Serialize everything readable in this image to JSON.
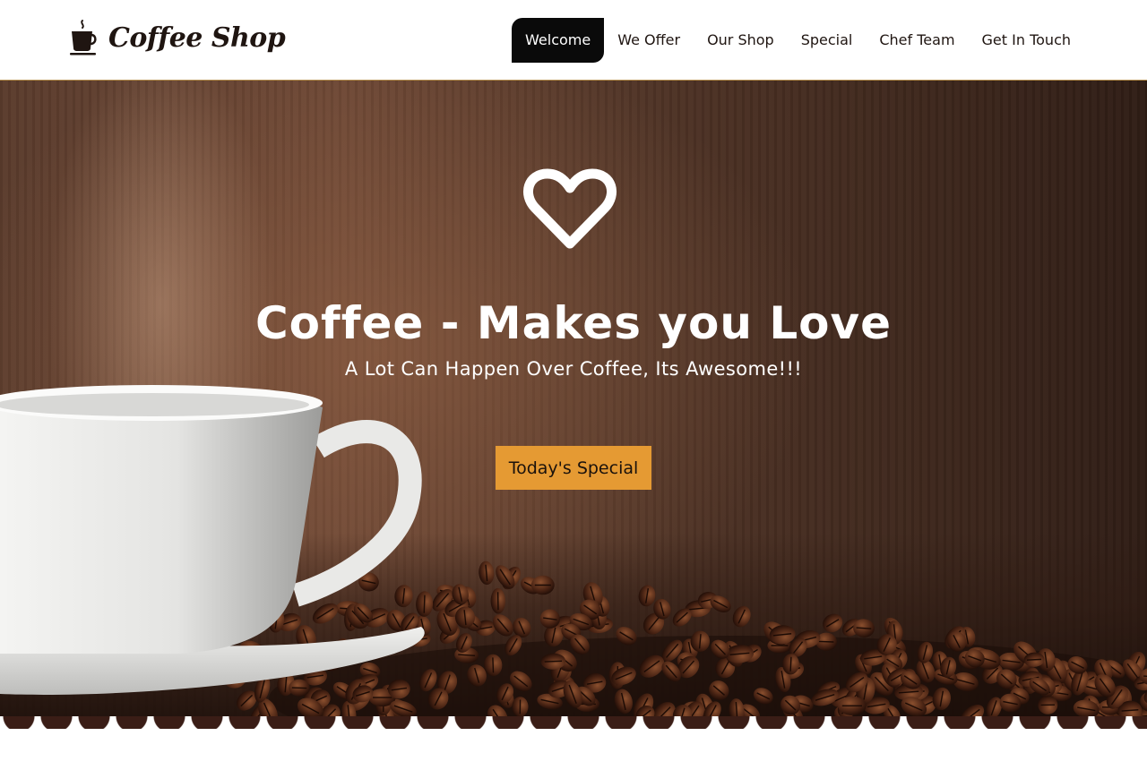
{
  "brand": {
    "name": "Coffee Shop",
    "icon": "coffee-cup-icon"
  },
  "nav": {
    "items": [
      {
        "label": "Welcome",
        "active": true
      },
      {
        "label": "We Offer",
        "active": false
      },
      {
        "label": "Our Shop",
        "active": false
      },
      {
        "label": "Special",
        "active": false
      },
      {
        "label": "Chef Team",
        "active": false
      },
      {
        "label": "Get In Touch",
        "active": false
      }
    ]
  },
  "hero": {
    "icon": "heart-outline-icon",
    "title": "Coffee - Makes you Love",
    "subtitle": "A Lot Can Happen Over Coffee, Its Awesome!!!",
    "cta_label": "Today's Special"
  },
  "colors": {
    "accent": "#e59a33",
    "active_nav_bg": "#0a0a0a",
    "brand_dark": "#1f1511",
    "scallop": "#3a1d16"
  }
}
